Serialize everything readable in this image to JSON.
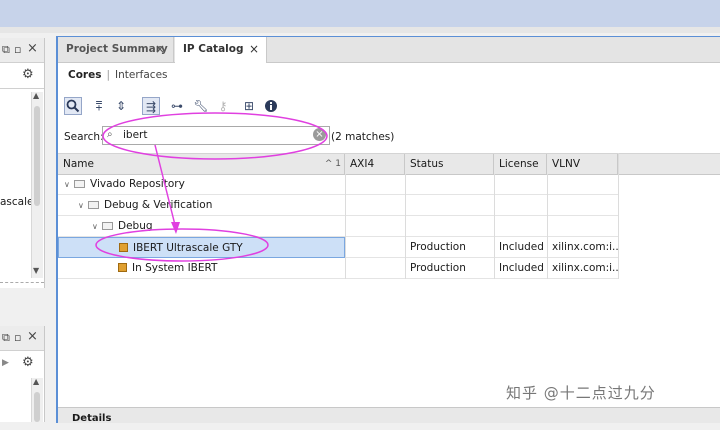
{
  "left_top_panel": {
    "icons": [
      "restore-icon",
      "maximize-icon",
      "close-icon",
      "gear-icon"
    ],
    "partial_text": "ascale_"
  },
  "left_bottom_panel": {
    "icons": [
      "restore-icon",
      "maximize-icon",
      "close-icon",
      "gear-icon"
    ]
  },
  "tabs": [
    {
      "label": "Project Summary",
      "close": "×"
    },
    {
      "label": "IP Catalog",
      "close": "×"
    }
  ],
  "subtabs": {
    "cores": "Cores",
    "separator": "|",
    "interfaces": "Interfaces"
  },
  "toolbar": [
    "search-icon",
    "collapse-all-icon",
    "expand-all-icon",
    "group-icon",
    "hierarchy-icon",
    "wrench-icon",
    "key-icon",
    "chip-icon",
    "info-icon"
  ],
  "search": {
    "label": "Search:",
    "value": "ibert",
    "matches": "(2 matches)"
  },
  "table": {
    "columns": [
      "Name",
      "AXI4",
      "Status",
      "License",
      "VLNV"
    ],
    "sort_indicator": "^ 1",
    "rows": [
      {
        "name": "Vivado Repository",
        "level": 0,
        "type": "folder",
        "axi4": "",
        "status": "",
        "license": "",
        "vlnv": ""
      },
      {
        "name": "Debug & Verification",
        "level": 1,
        "type": "folder",
        "axi4": "",
        "status": "",
        "license": "",
        "vlnv": ""
      },
      {
        "name": "Debug",
        "level": 2,
        "type": "folder",
        "axi4": "",
        "status": "",
        "license": "",
        "vlnv": ""
      },
      {
        "name": "IBERT Ultrascale GTY",
        "level": 3,
        "type": "ip",
        "axi4": "",
        "status": "Production",
        "license": "Included",
        "vlnv": "xilinx.com:i...",
        "selected": true
      },
      {
        "name": "In System IBERT",
        "level": 3,
        "type": "ip",
        "axi4": "",
        "status": "Production",
        "license": "Included",
        "vlnv": "xilinx.com:i..."
      }
    ]
  },
  "details": {
    "label": "Details"
  },
  "watermark": "知乎 @十二点过九分",
  "colors": {
    "topbar": "#c7d3ea",
    "selection": "#cde0f7",
    "annotation": "#e040e0",
    "accent": "#5b8fd6"
  }
}
